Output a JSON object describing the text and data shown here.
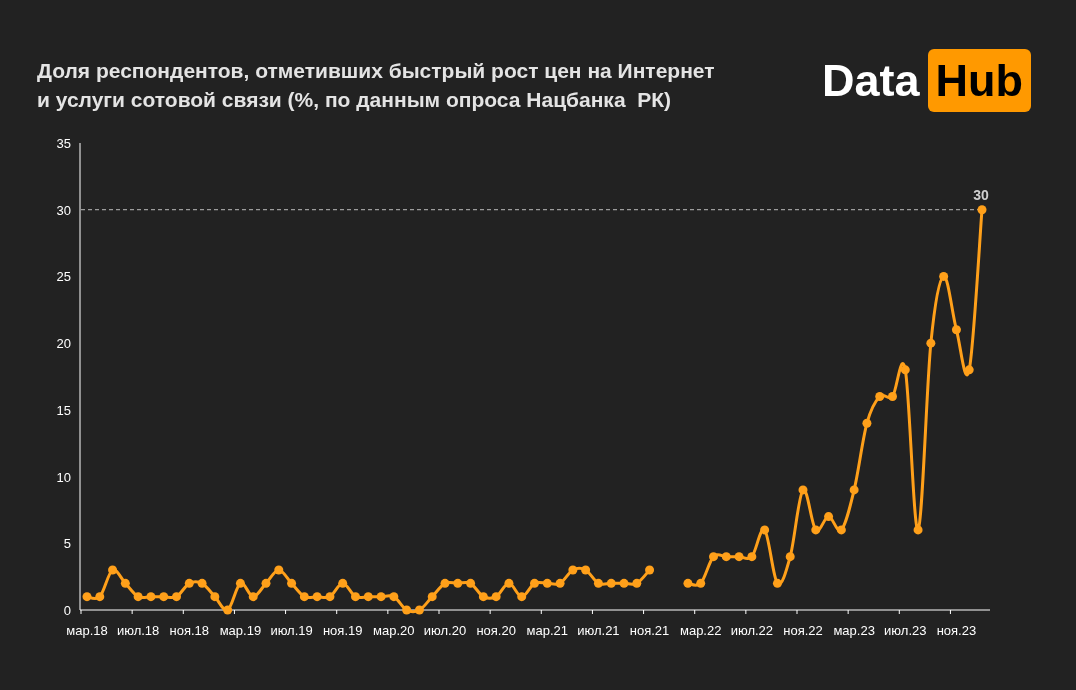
{
  "chart": {
    "chart_data": {
      "type": "line",
      "title": "Доля респондентов, отметивших быстрый рост цен на Интернет и услуги сотовой связи (%, по данным опроса Нацбанка  РК)",
      "categories": [
        "мар.18",
        null,
        null,
        null,
        "июл.18",
        null,
        null,
        null,
        "ноя.18",
        null,
        null,
        null,
        "мар.19",
        null,
        null,
        null,
        "июл.19",
        null,
        null,
        null,
        "ноя.19",
        null,
        null,
        null,
        "мар.20",
        null,
        null,
        null,
        "июл.20",
        null,
        null,
        null,
        "ноя.20",
        null,
        null,
        null,
        "мар.21",
        null,
        null,
        null,
        "июл.21",
        null,
        null,
        null,
        "ноя.21",
        null,
        null,
        null,
        "мар.22",
        null,
        null,
        null,
        "июл.22",
        null,
        null,
        null,
        "ноя.22",
        null,
        null,
        null,
        "мар.23",
        null,
        null,
        null,
        "июл.23",
        null,
        null,
        null,
        "ноя.23",
        null,
        null
      ],
      "series": [
        {
          "color": "#ffa01a",
          "marker": "circle",
          "values": [
            1,
            1,
            3,
            2,
            1,
            1,
            1,
            1,
            2,
            2,
            1,
            0,
            2,
            1,
            2,
            3,
            2,
            1,
            1,
            1,
            2,
            1,
            1,
            1,
            1,
            0,
            0,
            1,
            2,
            2,
            2,
            1,
            1,
            2,
            1,
            2,
            2,
            2,
            3,
            3,
            2,
            2,
            2,
            2,
            3,
            null,
            null,
            2,
            2,
            4,
            4,
            4,
            4,
            6,
            2,
            4,
            9,
            6,
            7,
            6,
            9,
            14,
            16,
            16,
            18,
            6,
            20,
            25,
            21,
            18,
            30
          ]
        }
      ],
      "ylim": [
        0,
        35
      ],
      "yticks": [
        0,
        5,
        10,
        15,
        20,
        25,
        30,
        35
      ],
      "annotations": [
        {
          "text": "30",
          "y": 30
        }
      ]
    }
  },
  "logo": {
    "text_1": "Data",
    "text_2": "Hub"
  }
}
